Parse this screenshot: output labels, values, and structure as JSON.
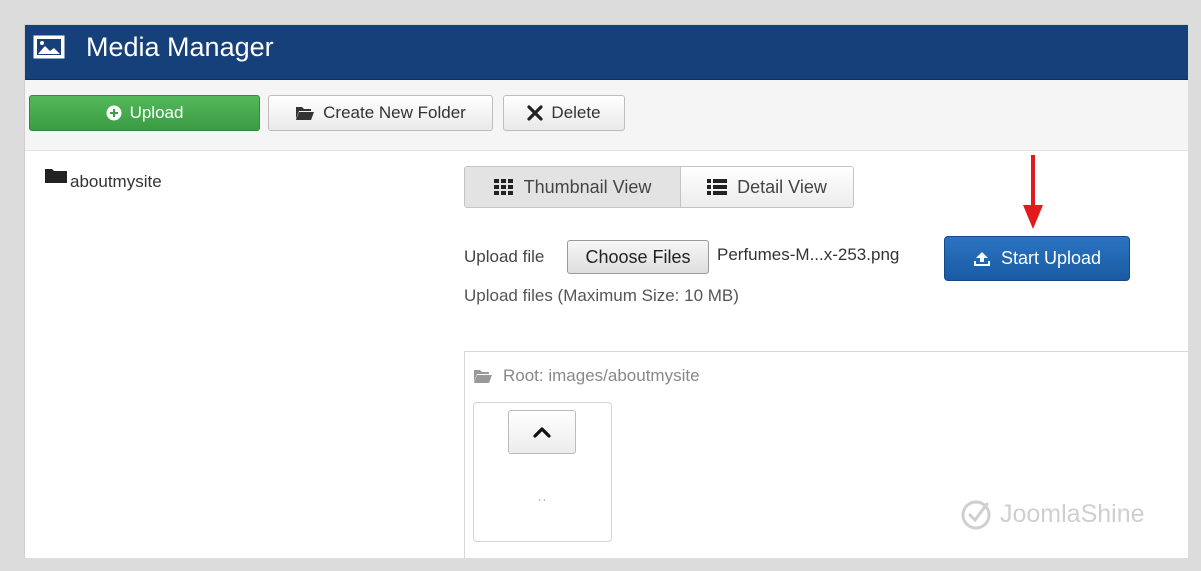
{
  "window": {
    "title": "Media Manager",
    "title_bar_color": "#16407a"
  },
  "toolbar": {
    "upload_label": "Upload",
    "create_folder_label": "Create New Folder",
    "delete_label": "Delete",
    "upload_color": "#3f9f47"
  },
  "sidebar": {
    "folders": [
      {
        "label": "aboutmysite"
      }
    ]
  },
  "views": {
    "thumbnail_label": "Thumbnail View",
    "detail_label": "Detail View",
    "active": "thumbnail"
  },
  "upload_form": {
    "label": "Upload file",
    "choose_label": "Choose Files",
    "file_name": "Perfumes-M...x-253.png",
    "start_label": "Start Upload",
    "max_size_text": "Upload files (Maximum Size: 10 MB)",
    "start_color": "#1f63ad"
  },
  "browser": {
    "root_path": "Root: images/aboutmysite",
    "parent_label": ".."
  },
  "annotation": {
    "arrow_color": "#e01b1b"
  },
  "watermark": {
    "text": "JoomlaShine"
  }
}
